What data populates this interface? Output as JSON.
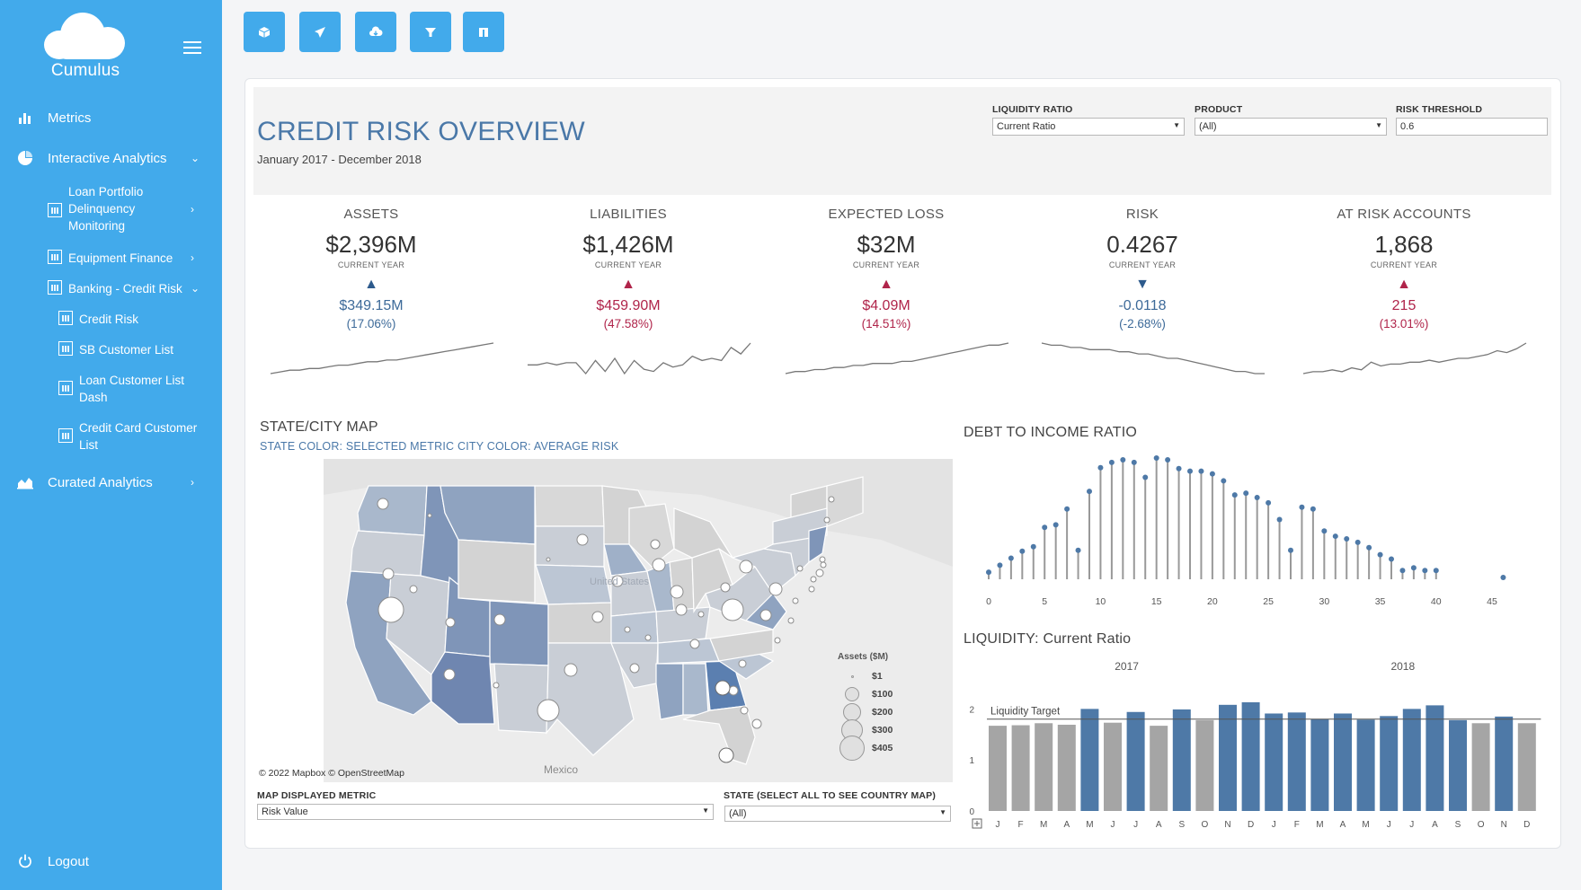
{
  "app": {
    "name": "Cumulus"
  },
  "sidebar": {
    "items": [
      {
        "label": "Metrics"
      },
      {
        "label": "Interactive Analytics"
      },
      {
        "label": "Curated Analytics"
      },
      {
        "label": "Logout"
      }
    ],
    "sub_items": [
      {
        "label": "Loan Portfolio Delinquency Monitoring"
      },
      {
        "label": "Equipment Finance"
      },
      {
        "label": "Banking - Credit Risk"
      },
      {
        "label": "Credit Risk"
      },
      {
        "label": "SB Customer List"
      },
      {
        "label": "Loan Customer List Dash"
      },
      {
        "label": "Credit Card Customer List"
      }
    ]
  },
  "toolbar": {
    "icons": [
      "box-icon",
      "send-icon",
      "cloud-download-icon",
      "filter-icon",
      "columns-icon"
    ]
  },
  "dashboard": {
    "title": "CREDIT RISK OVERVIEW",
    "subtitle": "January 2017 - December 2018",
    "filters": {
      "liquidity_ratio": {
        "label": "LIQUIDITY RATIO",
        "value": "Current Ratio"
      },
      "product": {
        "label": "PRODUCT",
        "value": "(All)"
      },
      "risk_threshold": {
        "label": "RISK THRESHOLD",
        "value": "0.6"
      }
    }
  },
  "kpis": [
    {
      "title": "ASSETS",
      "value": "$2,396M",
      "sub": "CURRENT YEAR",
      "direction": "up",
      "change": "$349.15M",
      "pct": "(17.06%)",
      "color": "#3d6a99",
      "arrow_color": "#2d5a8c",
      "trend": [
        2,
        3,
        4,
        4,
        5,
        5,
        6,
        7,
        7,
        8,
        9,
        9,
        10,
        10,
        11,
        12,
        13,
        14,
        15,
        16,
        17,
        18,
        19,
        20
      ]
    },
    {
      "title": "LIABILITIES",
      "value": "$1,426M",
      "sub": "CURRENT YEAR",
      "direction": "up",
      "change": "$459.90M",
      "pct": "(47.58%)",
      "color": "#b0244a",
      "arrow_color": "#b0244a",
      "trend": [
        8,
        8,
        9,
        8,
        9,
        9,
        4,
        10,
        5,
        11,
        4,
        10,
        6,
        5,
        9,
        7,
        8,
        12,
        10,
        11,
        10,
        16,
        13,
        18
      ]
    },
    {
      "title": "EXPECTED LOSS",
      "value": "$32M",
      "sub": "CURRENT YEAR",
      "direction": "up",
      "change": "$4.09M",
      "pct": "(14.51%)",
      "color": "#b0244a",
      "arrow_color": "#b0244a",
      "trend": [
        2,
        3,
        3,
        4,
        4,
        5,
        5,
        6,
        6,
        7,
        7,
        7,
        8,
        8,
        9,
        10,
        11,
        12,
        13,
        14,
        15,
        16,
        16,
        17
      ]
    },
    {
      "title": "RISK",
      "value": "0.4267",
      "sub": "CURRENT YEAR",
      "direction": "down",
      "change": "-0.0118",
      "pct": "(-2.68%)",
      "color": "#3d6a99",
      "arrow_color": "#2d5a8c",
      "trend": [
        17,
        16,
        16,
        15,
        15,
        14,
        14,
        14,
        13,
        13,
        12,
        12,
        11,
        10,
        10,
        9,
        8,
        7,
        6,
        5,
        4,
        4,
        3,
        3
      ]
    },
    {
      "title": "AT RISK ACCOUNTS",
      "value": "1,868",
      "sub": "CURRENT YEAR",
      "direction": "up",
      "change": "215",
      "pct": "(13.01%)",
      "color": "#b0244a",
      "arrow_color": "#b0244a",
      "trend": [
        4,
        5,
        5,
        6,
        5,
        7,
        6,
        10,
        8,
        9,
        9,
        10,
        10,
        11,
        10,
        11,
        12,
        12,
        13,
        14,
        16,
        15,
        17,
        20
      ]
    }
  ],
  "map": {
    "title": "STATE/CITY MAP",
    "state_color_label": "STATE COLOR: SELECTED METRIC",
    "city_color_label": "CITY COLOR: AVERAGE RISK",
    "copyright": "© 2022 Mapbox © OpenStreetMap",
    "country_label": "United States",
    "mexico_label": "Mexico",
    "legend_title": "Assets ($M)",
    "legend": [
      "$1",
      "$100",
      "$200",
      "$300",
      "$405"
    ],
    "metric_label": "MAP DISPLAYED METRIC",
    "metric_value": "Risk Value",
    "state_label": "STATE (SELECT ALL TO SEE COUNTRY MAP)",
    "state_value": "(All)"
  },
  "chart_data": [
    {
      "type": "lollipop",
      "title": "DEBT TO INCOME RATIO",
      "xlim": [
        0,
        45
      ],
      "xticks": [
        "0",
        "5",
        "10",
        "15",
        "20",
        "25",
        "30",
        "35",
        "40",
        "45"
      ],
      "x": [
        0,
        1,
        2,
        3,
        4,
        5,
        6,
        7,
        8,
        9,
        10,
        11,
        12,
        13,
        14,
        15,
        16,
        17,
        18,
        19,
        20,
        21,
        22,
        23,
        24,
        25,
        26,
        27,
        28,
        29,
        30,
        31,
        32,
        33,
        34,
        35,
        36,
        37,
        38,
        39,
        40,
        41,
        42,
        43,
        44,
        45
      ],
      "values": [
        8,
        16,
        24,
        32,
        37,
        59,
        62,
        80,
        33,
        100,
        127,
        133,
        136,
        133,
        116,
        138,
        136,
        126,
        123,
        123,
        120,
        112,
        96,
        98,
        93,
        87,
        68,
        33,
        82,
        80,
        55,
        49,
        46,
        42,
        36,
        28,
        23,
        10,
        13,
        10,
        10,
        0,
        0,
        0,
        0,
        0
      ],
      "extra_point": {
        "x": 46,
        "value": 2
      }
    },
    {
      "type": "bar",
      "title": "LIQUIDITY: Current Ratio",
      "years": [
        "2017",
        "2018"
      ],
      "categories": [
        "J",
        "F",
        "M",
        "A",
        "M",
        "J",
        "J",
        "A",
        "S",
        "O",
        "N",
        "D",
        "J",
        "F",
        "M",
        "A",
        "M",
        "J",
        "J",
        "A",
        "S",
        "O",
        "N",
        "D"
      ],
      "values": [
        1.67,
        1.68,
        1.72,
        1.69,
        2.0,
        1.73,
        1.94,
        1.67,
        1.99,
        1.78,
        2.08,
        2.13,
        1.91,
        1.93,
        1.8,
        1.91,
        1.79,
        1.86,
        2.0,
        2.07,
        1.78,
        1.72,
        1.85,
        1.72
      ],
      "above_target": [
        false,
        false,
        false,
        false,
        true,
        false,
        true,
        false,
        true,
        false,
        true,
        true,
        true,
        true,
        true,
        true,
        true,
        true,
        true,
        true,
        true,
        false,
        true,
        false
      ],
      "target": 1.8,
      "target_label": "Liquidity Target",
      "ylim": [
        0,
        2.2
      ],
      "yticks": [
        "0",
        "1",
        "2"
      ],
      "colors": {
        "above": "#4e79a7",
        "below": "#a5a5a5"
      }
    }
  ]
}
